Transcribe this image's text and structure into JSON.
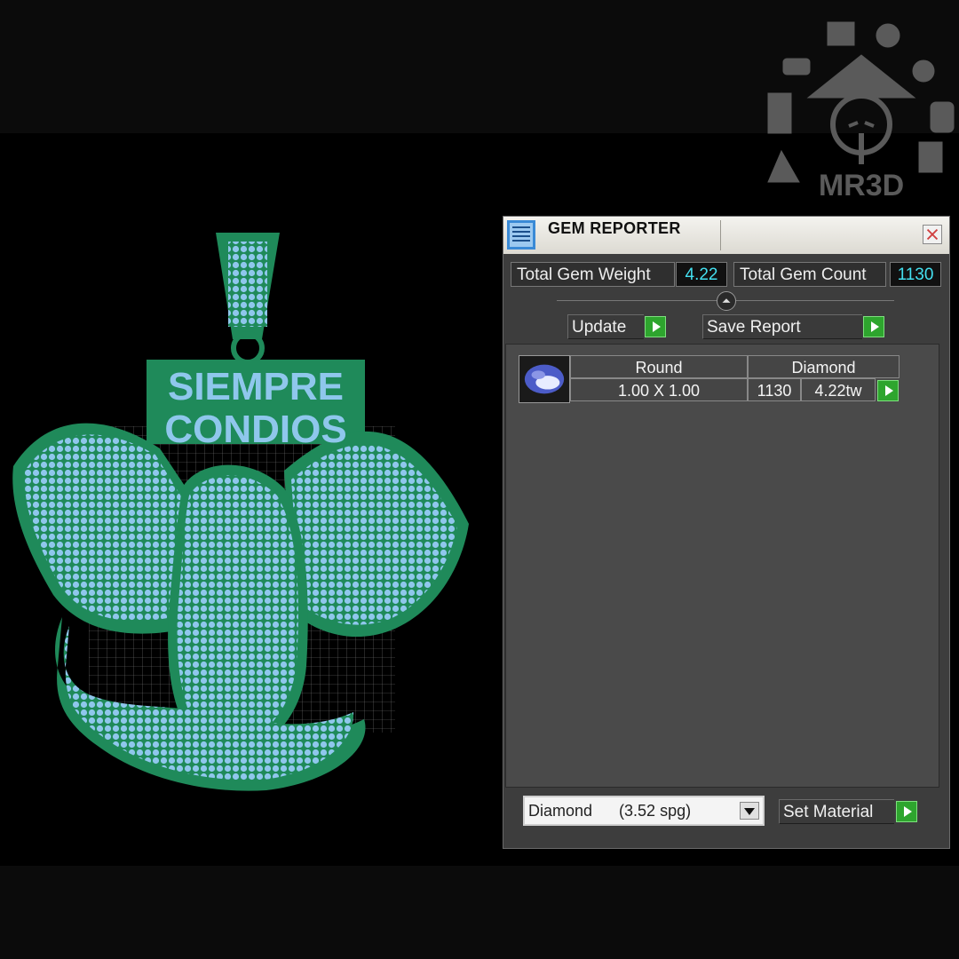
{
  "window": {
    "title": "GEM REPORTER",
    "close_icon": "close-icon",
    "title_icon": "report-icon"
  },
  "stats": {
    "weight_label": "Total Gem Weight",
    "weight_value": "4.22",
    "count_label": "Total Gem Count",
    "count_value": "1130"
  },
  "actions": {
    "update_label": "Update",
    "save_label": "Save Report"
  },
  "gem_list": [
    {
      "shape": "Round",
      "material": "Diamond",
      "size": "1.00 X 1.00",
      "count": "1130",
      "weight": "4.22tw",
      "thumbnail_icon": "round-gem-icon"
    }
  ],
  "material": {
    "selected": "Diamond      (3.52 spg)",
    "set_label": "Set Material"
  },
  "viewport": {
    "model_text_line1": "SIEMPRE",
    "model_text_line2": "CONDIOS",
    "model_description_icon": "eagle-pendant-model"
  },
  "watermark": {
    "text": "MR3D"
  },
  "colors": {
    "gem_blue": "#8fc7ec",
    "metal_green": "#1f8a5a",
    "value_cyan": "#44e0f0",
    "button_green": "#2ea52e"
  }
}
